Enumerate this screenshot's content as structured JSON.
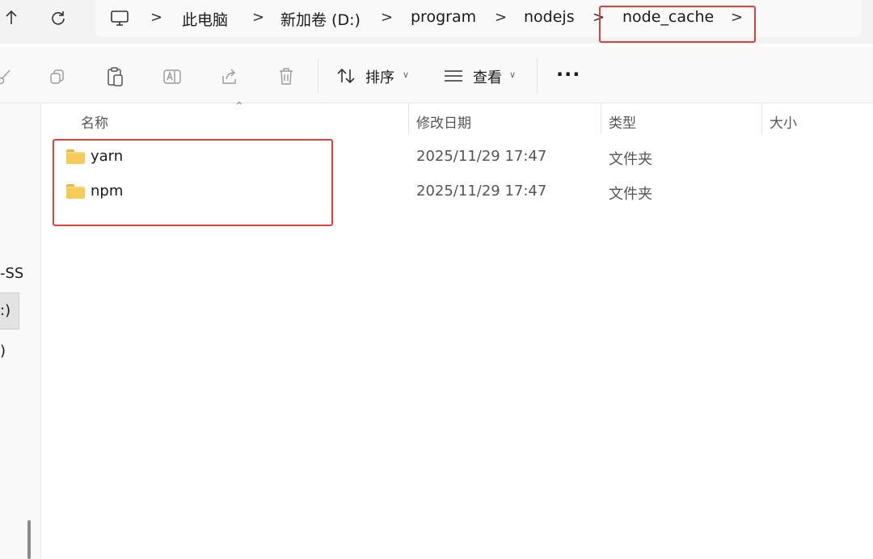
{
  "address_bar": {
    "up_icon": "arrow-up-icon",
    "refresh_icon": "refresh-icon",
    "computer_icon": "computer-icon",
    "breadcrumbs": [
      "此电脑",
      "新加卷 (D:)",
      "program",
      "nodejs",
      "node_cache"
    ],
    "separator": ">"
  },
  "toolbar": {
    "icons": [
      "cut-icon",
      "copy-icon",
      "paste-icon",
      "rename-icon",
      "share-icon",
      "delete-icon"
    ],
    "sort_label": "排序",
    "view_label": "查看",
    "more_label": "..."
  },
  "navpane": {
    "partial_items": [
      "-SS",
      ":)",
      ")"
    ]
  },
  "columns": {
    "name": "名称",
    "modified": "修改日期",
    "type": "类型",
    "size": "大小"
  },
  "files": [
    {
      "name": "yarn",
      "modified": "2025/11/29 17:47",
      "type": "文件夹",
      "size": ""
    },
    {
      "name": "npm",
      "modified": "2025/11/29 17:47",
      "type": "文件夹",
      "size": ""
    }
  ],
  "colors": {
    "highlight": "#e0413f",
    "folder": "#f7cb5a"
  }
}
